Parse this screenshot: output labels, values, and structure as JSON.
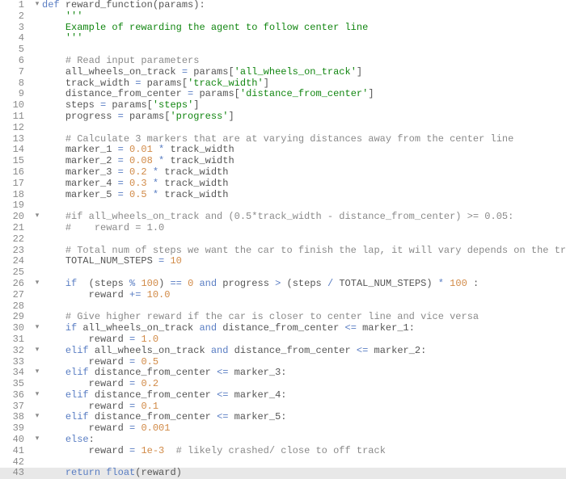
{
  "editor": {
    "highlighted_line": 43,
    "lines": [
      {
        "num": 1,
        "fold": "▾",
        "indent": 0,
        "tokens": [
          [
            "kw",
            "def"
          ],
          [
            "def",
            " "
          ],
          [
            "fn",
            "reward_function"
          ],
          [
            "punct",
            "("
          ],
          [
            "ident",
            "params"
          ],
          [
            "punct",
            "):"
          ]
        ]
      },
      {
        "num": 2,
        "fold": "",
        "indent": 1,
        "tokens": [
          [
            "str",
            "'''"
          ]
        ]
      },
      {
        "num": 3,
        "fold": "",
        "indent": 1,
        "tokens": [
          [
            "str",
            "Example of rewarding the agent to follow center line"
          ]
        ]
      },
      {
        "num": 4,
        "fold": "",
        "indent": 1,
        "tokens": [
          [
            "str",
            "'''"
          ]
        ]
      },
      {
        "num": 5,
        "fold": "",
        "indent": 0,
        "tokens": []
      },
      {
        "num": 6,
        "fold": "",
        "indent": 1,
        "tokens": [
          [
            "comment",
            "# Read input parameters"
          ]
        ]
      },
      {
        "num": 7,
        "fold": "",
        "indent": 1,
        "tokens": [
          [
            "ident",
            "all_wheels_on_track "
          ],
          [
            "op",
            "="
          ],
          [
            "ident",
            " params"
          ],
          [
            "punct",
            "["
          ],
          [
            "str",
            "'all_wheels_on_track'"
          ],
          [
            "punct",
            "]"
          ]
        ]
      },
      {
        "num": 8,
        "fold": "",
        "indent": 1,
        "tokens": [
          [
            "ident",
            "track_width "
          ],
          [
            "op",
            "="
          ],
          [
            "ident",
            " params"
          ],
          [
            "punct",
            "["
          ],
          [
            "str",
            "'track_width'"
          ],
          [
            "punct",
            "]"
          ]
        ]
      },
      {
        "num": 9,
        "fold": "",
        "indent": 1,
        "tokens": [
          [
            "ident",
            "distance_from_center "
          ],
          [
            "op",
            "="
          ],
          [
            "ident",
            " params"
          ],
          [
            "punct",
            "["
          ],
          [
            "str",
            "'distance_from_center'"
          ],
          [
            "punct",
            "]"
          ]
        ]
      },
      {
        "num": 10,
        "fold": "",
        "indent": 1,
        "tokens": [
          [
            "ident",
            "steps "
          ],
          [
            "op",
            "="
          ],
          [
            "ident",
            " params"
          ],
          [
            "punct",
            "["
          ],
          [
            "str",
            "'steps'"
          ],
          [
            "punct",
            "]"
          ]
        ]
      },
      {
        "num": 11,
        "fold": "",
        "indent": 1,
        "tokens": [
          [
            "ident",
            "progress "
          ],
          [
            "op",
            "="
          ],
          [
            "ident",
            " params"
          ],
          [
            "punct",
            "["
          ],
          [
            "str",
            "'progress'"
          ],
          [
            "punct",
            "]"
          ]
        ]
      },
      {
        "num": 12,
        "fold": "",
        "indent": 0,
        "tokens": []
      },
      {
        "num": 13,
        "fold": "",
        "indent": 1,
        "tokens": [
          [
            "comment",
            "# Calculate 3 markers that are at varying distances away from the center line"
          ]
        ]
      },
      {
        "num": 14,
        "fold": "",
        "indent": 1,
        "tokens": [
          [
            "ident",
            "marker_1 "
          ],
          [
            "op",
            "="
          ],
          [
            "ident",
            " "
          ],
          [
            "num",
            "0.01"
          ],
          [
            "ident",
            " "
          ],
          [
            "op",
            "*"
          ],
          [
            "ident",
            " track_width"
          ]
        ]
      },
      {
        "num": 15,
        "fold": "",
        "indent": 1,
        "tokens": [
          [
            "ident",
            "marker_2 "
          ],
          [
            "op",
            "="
          ],
          [
            "ident",
            " "
          ],
          [
            "num",
            "0.08"
          ],
          [
            "ident",
            " "
          ],
          [
            "op",
            "*"
          ],
          [
            "ident",
            " track_width"
          ]
        ]
      },
      {
        "num": 16,
        "fold": "",
        "indent": 1,
        "tokens": [
          [
            "ident",
            "marker_3 "
          ],
          [
            "op",
            "="
          ],
          [
            "ident",
            " "
          ],
          [
            "num",
            "0.2"
          ],
          [
            "ident",
            " "
          ],
          [
            "op",
            "*"
          ],
          [
            "ident",
            " track_width"
          ]
        ]
      },
      {
        "num": 17,
        "fold": "",
        "indent": 1,
        "tokens": [
          [
            "ident",
            "marker_4 "
          ],
          [
            "op",
            "="
          ],
          [
            "ident",
            " "
          ],
          [
            "num",
            "0.3"
          ],
          [
            "ident",
            " "
          ],
          [
            "op",
            "*"
          ],
          [
            "ident",
            " track_width"
          ]
        ]
      },
      {
        "num": 18,
        "fold": "",
        "indent": 1,
        "tokens": [
          [
            "ident",
            "marker_5 "
          ],
          [
            "op",
            "="
          ],
          [
            "ident",
            " "
          ],
          [
            "num",
            "0.5"
          ],
          [
            "ident",
            " "
          ],
          [
            "op",
            "*"
          ],
          [
            "ident",
            " track_width"
          ]
        ]
      },
      {
        "num": 19,
        "fold": "",
        "indent": 0,
        "tokens": []
      },
      {
        "num": 20,
        "fold": "▾",
        "indent": 1,
        "tokens": [
          [
            "comment",
            "#if all_wheels_on_track and (0.5*track_width - distance_from_center) >= 0.05:"
          ]
        ]
      },
      {
        "num": 21,
        "fold": "",
        "indent": 1,
        "tokens": [
          [
            "comment",
            "#    reward = 1.0"
          ]
        ]
      },
      {
        "num": 22,
        "fold": "",
        "indent": 0,
        "tokens": []
      },
      {
        "num": 23,
        "fold": "",
        "indent": 1,
        "tokens": [
          [
            "comment",
            "# Total num of steps we want the car to finish the lap, it will vary depends on the track length"
          ]
        ]
      },
      {
        "num": 24,
        "fold": "",
        "indent": 1,
        "tokens": [
          [
            "ident",
            "TOTAL_NUM_STEPS "
          ],
          [
            "op",
            "="
          ],
          [
            "ident",
            " "
          ],
          [
            "num",
            "10"
          ]
        ]
      },
      {
        "num": 25,
        "fold": "",
        "indent": 0,
        "tokens": []
      },
      {
        "num": 26,
        "fold": "▾",
        "indent": 1,
        "tokens": [
          [
            "kw",
            "if"
          ],
          [
            "ident",
            "  "
          ],
          [
            "punct",
            "("
          ],
          [
            "ident",
            "steps "
          ],
          [
            "op",
            "%"
          ],
          [
            "ident",
            " "
          ],
          [
            "num",
            "100"
          ],
          [
            "punct",
            ")"
          ],
          [
            "ident",
            " "
          ],
          [
            "op",
            "=="
          ],
          [
            "ident",
            " "
          ],
          [
            "num",
            "0"
          ],
          [
            "ident",
            " "
          ],
          [
            "kw",
            "and"
          ],
          [
            "ident",
            " progress "
          ],
          [
            "op",
            ">"
          ],
          [
            "ident",
            " "
          ],
          [
            "punct",
            "("
          ],
          [
            "ident",
            "steps "
          ],
          [
            "op",
            "/"
          ],
          [
            "ident",
            " TOTAL_NUM_STEPS"
          ],
          [
            "punct",
            ")"
          ],
          [
            "ident",
            " "
          ],
          [
            "op",
            "*"
          ],
          [
            "ident",
            " "
          ],
          [
            "num",
            "100"
          ],
          [
            "ident",
            " "
          ],
          [
            "punct",
            ":"
          ]
        ]
      },
      {
        "num": 27,
        "fold": "",
        "indent": 2,
        "tokens": [
          [
            "ident",
            "reward "
          ],
          [
            "op",
            "+="
          ],
          [
            "ident",
            " "
          ],
          [
            "num",
            "10.0"
          ]
        ]
      },
      {
        "num": 28,
        "fold": "",
        "indent": 0,
        "tokens": []
      },
      {
        "num": 29,
        "fold": "",
        "indent": 1,
        "tokens": [
          [
            "comment",
            "# Give higher reward if the car is closer to center line and vice versa"
          ]
        ]
      },
      {
        "num": 30,
        "fold": "▾",
        "indent": 1,
        "tokens": [
          [
            "kw",
            "if"
          ],
          [
            "ident",
            " all_wheels_on_track "
          ],
          [
            "kw",
            "and"
          ],
          [
            "ident",
            " distance_from_center "
          ],
          [
            "op",
            "<="
          ],
          [
            "ident",
            " marker_1"
          ],
          [
            "punct",
            ":"
          ]
        ]
      },
      {
        "num": 31,
        "fold": "",
        "indent": 2,
        "tokens": [
          [
            "ident",
            "reward "
          ],
          [
            "op",
            "="
          ],
          [
            "ident",
            " "
          ],
          [
            "num",
            "1.0"
          ]
        ]
      },
      {
        "num": 32,
        "fold": "▾",
        "indent": 1,
        "tokens": [
          [
            "kw",
            "elif"
          ],
          [
            "ident",
            " all_wheels_on_track "
          ],
          [
            "kw",
            "and"
          ],
          [
            "ident",
            " distance_from_center "
          ],
          [
            "op",
            "<="
          ],
          [
            "ident",
            " marker_2"
          ],
          [
            "punct",
            ":"
          ]
        ]
      },
      {
        "num": 33,
        "fold": "",
        "indent": 2,
        "tokens": [
          [
            "ident",
            "reward "
          ],
          [
            "op",
            "="
          ],
          [
            "ident",
            " "
          ],
          [
            "num",
            "0.5"
          ]
        ]
      },
      {
        "num": 34,
        "fold": "▾",
        "indent": 1,
        "tokens": [
          [
            "kw",
            "elif"
          ],
          [
            "ident",
            " distance_from_center "
          ],
          [
            "op",
            "<="
          ],
          [
            "ident",
            " marker_3"
          ],
          [
            "punct",
            ":"
          ]
        ]
      },
      {
        "num": 35,
        "fold": "",
        "indent": 2,
        "tokens": [
          [
            "ident",
            "reward "
          ],
          [
            "op",
            "="
          ],
          [
            "ident",
            " "
          ],
          [
            "num",
            "0.2"
          ]
        ]
      },
      {
        "num": 36,
        "fold": "▾",
        "indent": 1,
        "tokens": [
          [
            "kw",
            "elif"
          ],
          [
            "ident",
            " distance_from_center "
          ],
          [
            "op",
            "<="
          ],
          [
            "ident",
            " marker_4"
          ],
          [
            "punct",
            ":"
          ]
        ]
      },
      {
        "num": 37,
        "fold": "",
        "indent": 2,
        "tokens": [
          [
            "ident",
            "reward "
          ],
          [
            "op",
            "="
          ],
          [
            "ident",
            " "
          ],
          [
            "num",
            "0.1"
          ]
        ]
      },
      {
        "num": 38,
        "fold": "▾",
        "indent": 1,
        "tokens": [
          [
            "kw",
            "elif"
          ],
          [
            "ident",
            " distance_from_center "
          ],
          [
            "op",
            "<="
          ],
          [
            "ident",
            " marker_5"
          ],
          [
            "punct",
            ":"
          ]
        ]
      },
      {
        "num": 39,
        "fold": "",
        "indent": 2,
        "tokens": [
          [
            "ident",
            "reward "
          ],
          [
            "op",
            "="
          ],
          [
            "ident",
            " "
          ],
          [
            "num",
            "0.001"
          ]
        ]
      },
      {
        "num": 40,
        "fold": "▾",
        "indent": 1,
        "tokens": [
          [
            "kw",
            "else"
          ],
          [
            "punct",
            ":"
          ]
        ]
      },
      {
        "num": 41,
        "fold": "",
        "indent": 2,
        "tokens": [
          [
            "ident",
            "reward "
          ],
          [
            "op",
            "="
          ],
          [
            "ident",
            " "
          ],
          [
            "num",
            "1e-3"
          ],
          [
            "ident",
            "  "
          ],
          [
            "comment",
            "# likely crashed/ close to off track"
          ]
        ]
      },
      {
        "num": 42,
        "fold": "",
        "indent": 0,
        "tokens": []
      },
      {
        "num": 43,
        "fold": "",
        "indent": 1,
        "tokens": [
          [
            "kw",
            "return"
          ],
          [
            "ident",
            " "
          ],
          [
            "builtin",
            "float"
          ],
          [
            "punct",
            "("
          ],
          [
            "ident",
            "reward"
          ],
          [
            "punct",
            ")"
          ]
        ]
      }
    ]
  }
}
